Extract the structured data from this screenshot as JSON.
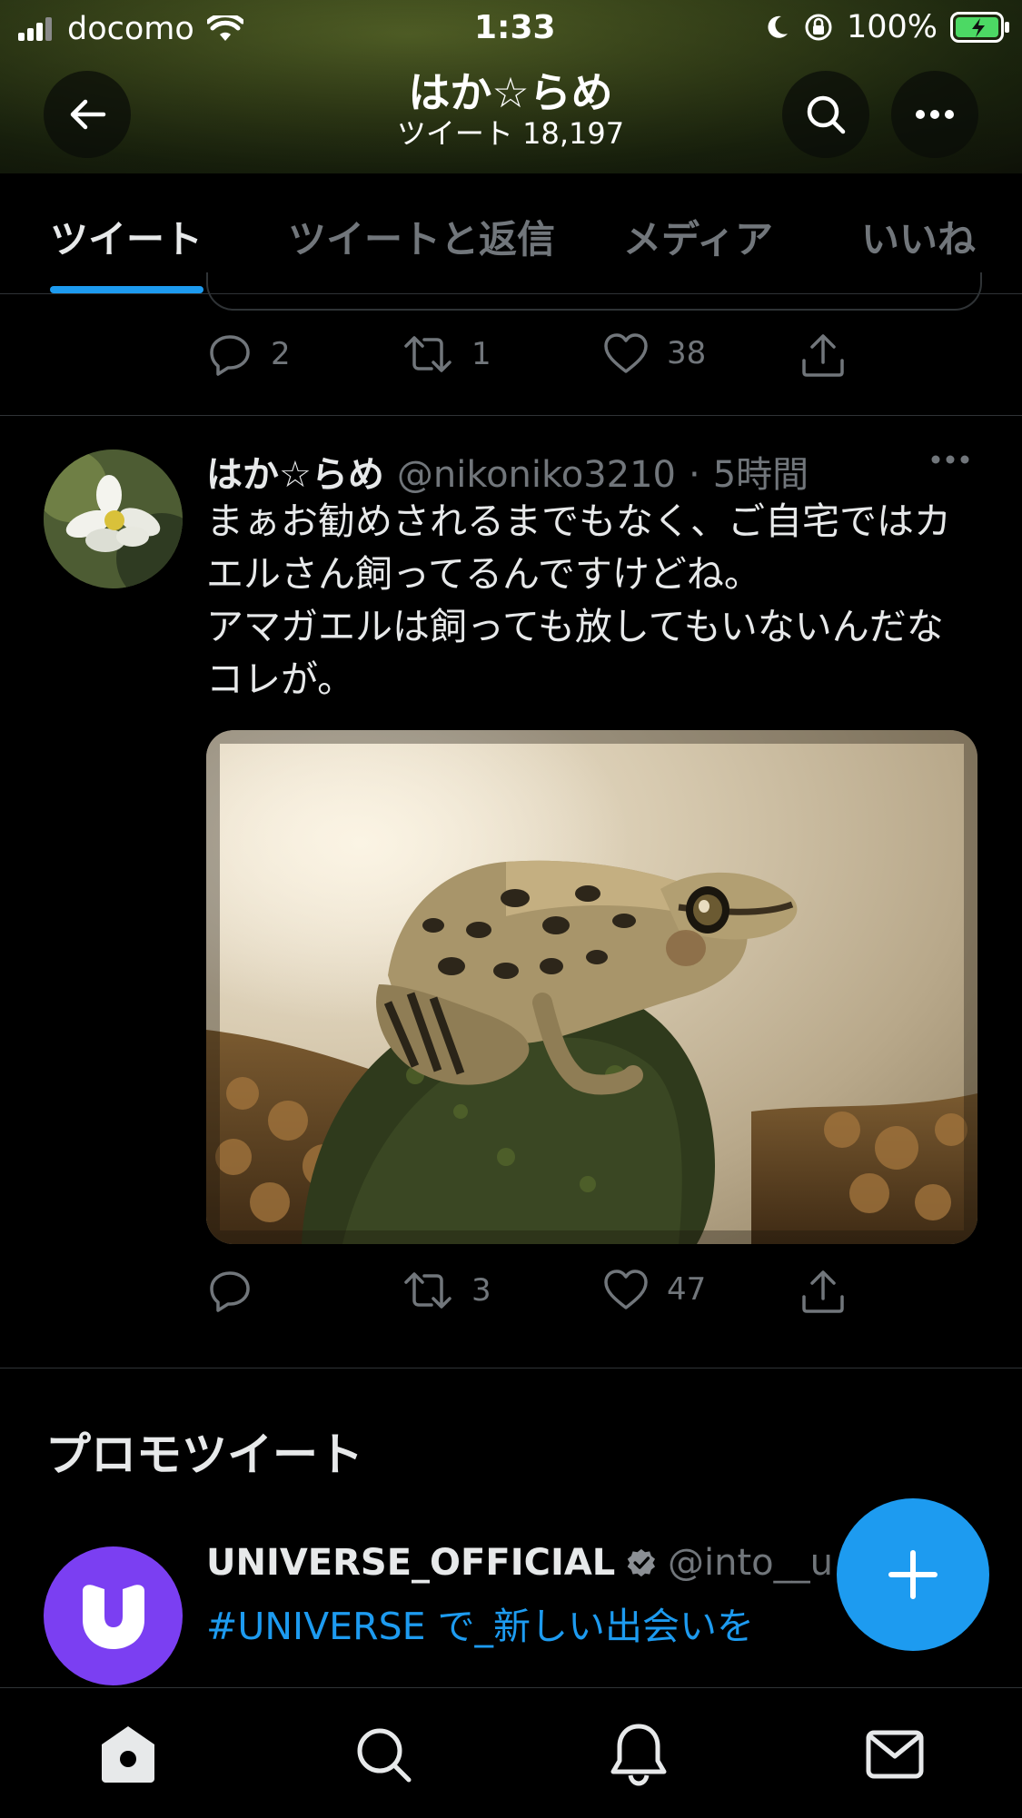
{
  "status_bar": {
    "carrier": "docomo",
    "time": "1:33",
    "battery": "100%"
  },
  "header": {
    "title": "はか☆らめ",
    "subtitle": "ツイート 18,197"
  },
  "tabs": [
    {
      "label": "ツイート",
      "active": true
    },
    {
      "label": "ツイートと返信",
      "active": false
    },
    {
      "label": "メディア",
      "active": false
    },
    {
      "label": "いいね",
      "active": false
    }
  ],
  "prev_tweet": {
    "replies": "2",
    "retweets": "1",
    "likes": "38"
  },
  "tweet": {
    "name": "はか☆らめ",
    "handle": "@nikoniko3210",
    "sep": "·",
    "time": "5時間",
    "text_lines": [
      "まぁお勧めされるまでもなく、ご自宅ではカ",
      "エルさん飼ってるんですけどね。",
      "アマガエルは飼っても放してもいないんだな",
      "コレが。"
    ],
    "replies": "",
    "retweets": "3",
    "likes": "47"
  },
  "promo": {
    "heading": "プロモツイート",
    "name": "UNIVERSE_OFFICIAL",
    "handle": "@into__u",
    "hashtag": "#UNIVERSE",
    "text": " で_新しい出会いを"
  },
  "colors": {
    "accent": "#1d9bf0",
    "background": "#000000",
    "muted": "#71767b",
    "promo_avatar": "#7b3ff2"
  },
  "icons": [
    "back-arrow-icon",
    "search-icon",
    "more-icon",
    "reply-icon",
    "retweet-icon",
    "like-icon",
    "share-icon",
    "verified-icon",
    "compose-icon",
    "home-icon",
    "notifications-icon",
    "messages-icon"
  ]
}
